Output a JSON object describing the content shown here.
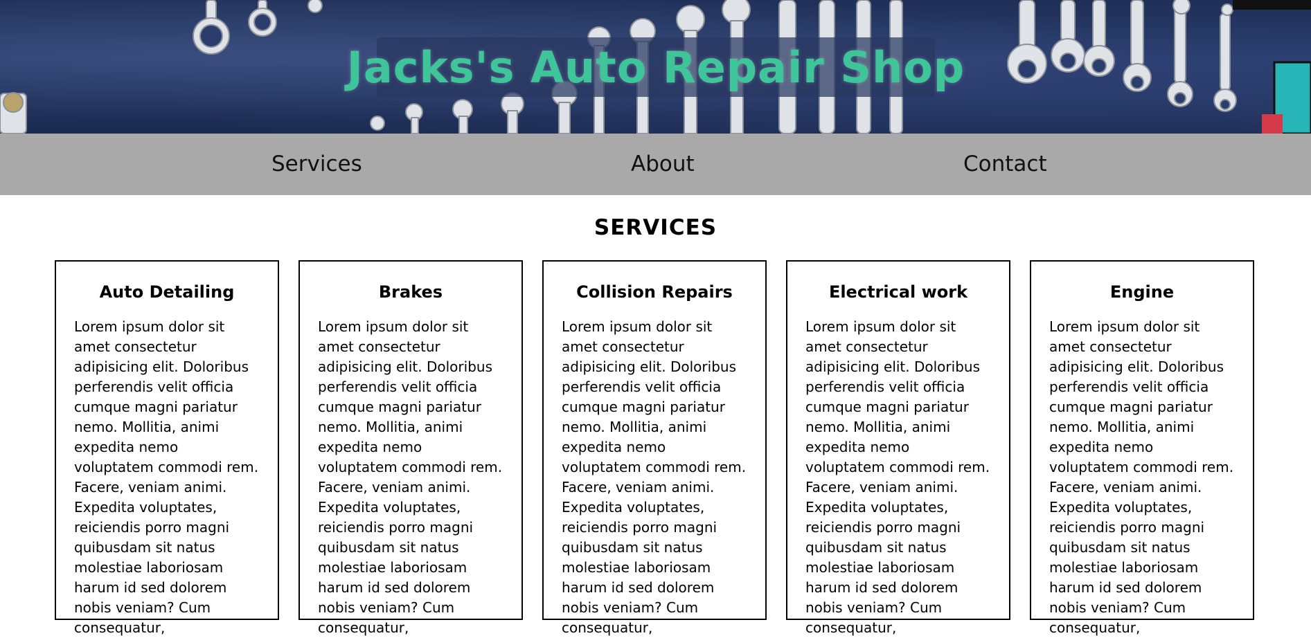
{
  "header": {
    "title": "Jacks's Auto Repair Shop"
  },
  "nav": {
    "items": [
      {
        "label": "Services"
      },
      {
        "label": "About"
      },
      {
        "label": "Contact"
      }
    ]
  },
  "services": {
    "heading": "SERVICES",
    "cards": [
      {
        "title": "Auto Detailing",
        "text": "Lorem ipsum dolor sit amet consectetur adipisicing elit. Doloribus perferendis velit officia cumque magni pariatur nemo. Mollitia, animi expedita nemo voluptatem commodi rem. Facere, veniam animi. Expedita voluptates, reiciendis porro magni quibusdam sit natus molestiae laboriosam harum id sed dolorem nobis veniam? Cum consequatur,"
      },
      {
        "title": "Brakes",
        "text": "Lorem ipsum dolor sit amet consectetur adipisicing elit. Doloribus perferendis velit officia cumque magni pariatur nemo. Mollitia, animi expedita nemo voluptatem commodi rem. Facere, veniam animi. Expedita voluptates, reiciendis porro magni quibusdam sit natus molestiae laboriosam harum id sed dolorem nobis veniam? Cum consequatur,"
      },
      {
        "title": "Collision Repairs",
        "text": "Lorem ipsum dolor sit amet consectetur adipisicing elit. Doloribus perferendis velit officia cumque magni pariatur nemo. Mollitia, animi expedita nemo voluptatem commodi rem. Facere, veniam animi. Expedita voluptates, reiciendis porro magni quibusdam sit natus molestiae laboriosam harum id sed dolorem nobis veniam? Cum consequatur,"
      },
      {
        "title": "Electrical work",
        "text": "Lorem ipsum dolor sit amet consectetur adipisicing elit. Doloribus perferendis velit officia cumque magni pariatur nemo. Mollitia, animi expedita nemo voluptatem commodi rem. Facere, veniam animi. Expedita voluptates, reiciendis porro magni quibusdam sit natus molestiae laboriosam harum id sed dolorem nobis veniam? Cum consequatur,"
      },
      {
        "title": "Engine",
        "text": "Lorem ipsum dolor sit amet consectetur adipisicing elit. Doloribus perferendis velit officia cumque magni pariatur nemo. Mollitia, animi expedita nemo voluptatem commodi rem. Facere, veniam animi. Expedita voluptates, reiciendis porro magni quibusdam sit natus molestiae laboriosam harum id sed dolorem nobis veniam? Cum consequatur,"
      }
    ]
  },
  "colors": {
    "title_green": "#3fc59a",
    "nav_bg": "#a9a9a9",
    "hero_blue": "#24365f"
  },
  "icons": {
    "hero_image": "wrench-wall-image"
  }
}
